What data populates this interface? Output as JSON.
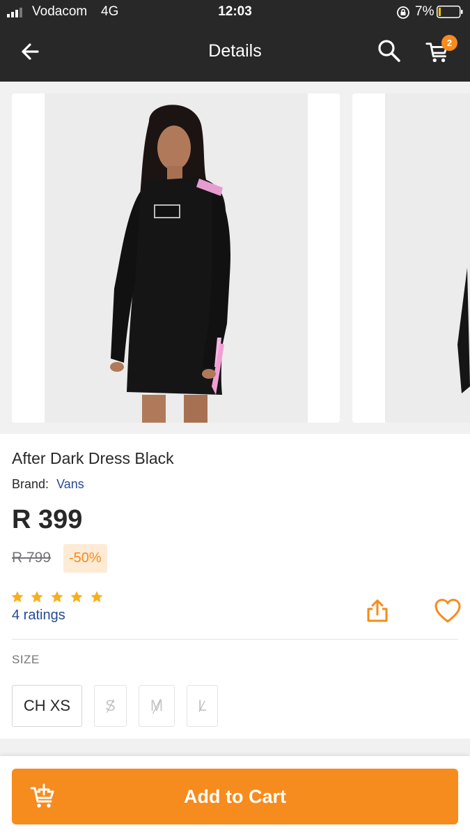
{
  "status_bar": {
    "carrier": "Vodacom",
    "network": "4G",
    "time": "12:03",
    "battery_percent": "7%"
  },
  "header": {
    "title": "Details",
    "back_icon": "arrow-left-icon",
    "search_icon": "search-icon",
    "cart_icon": "cart-icon",
    "cart_count": "2"
  },
  "gallery": {
    "images": [
      {
        "alt": "Model wearing black long-sleeve dress with pink stripe"
      },
      {
        "alt": "Model wearing black dress, second view"
      }
    ]
  },
  "product": {
    "name": "After Dark Dress Black",
    "brand_label": "Brand:",
    "brand": "Vans",
    "price": "R 399",
    "old_price": "R 799",
    "discount": "-50%",
    "rating_stars": 5,
    "ratings_text": "4 ratings",
    "share_icon": "share-icon",
    "favorite_icon": "heart-icon"
  },
  "size": {
    "label": "SIZE",
    "options": [
      {
        "label": "CH XS",
        "available": true
      },
      {
        "label": "S",
        "available": false
      },
      {
        "label": "M",
        "available": false
      },
      {
        "label": "L",
        "available": false
      }
    ]
  },
  "actions": {
    "add_to_cart": "Add to Cart",
    "add_to_cart_icon": "add-to-cart-icon"
  },
  "colors": {
    "accent": "#f68b1e",
    "header_bg": "#282828",
    "link": "#264996",
    "discount_bg": "#fdebd6"
  }
}
